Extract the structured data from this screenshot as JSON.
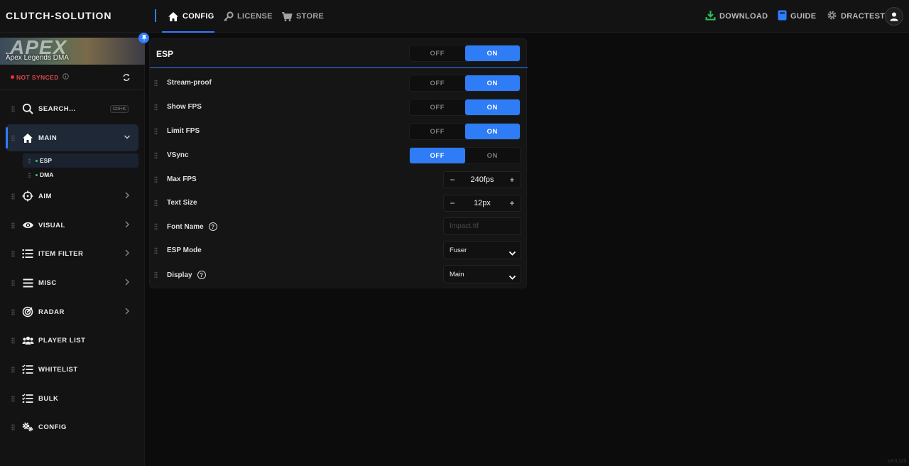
{
  "app": {
    "brand": "CLUTCH-SOLUTION",
    "version": "v3.0.113"
  },
  "topnav": [
    {
      "label": "CONFIG",
      "icon": "home-icon",
      "active": true
    },
    {
      "label": "LICENSE",
      "icon": "key-icon",
      "active": false
    },
    {
      "label": "STORE",
      "icon": "cart-icon",
      "active": false
    }
  ],
  "topright": {
    "download": "DOWNLOAD",
    "guide": "GUIDE",
    "user": "DRACTEST"
  },
  "sidebar": {
    "banner_logo": "APEX",
    "game": "Apex Legends DMA",
    "sync_status": "NOT SYNCED",
    "search": {
      "label": "SEARCH...",
      "shortcut": "Ctrl+K"
    },
    "items": [
      {
        "label": "MAIN",
        "icon": "home-icon"
      },
      {
        "label": "AIM",
        "icon": "crosshair-icon"
      },
      {
        "label": "VISUAL",
        "icon": "eye-icon"
      },
      {
        "label": "ITEM FILTER",
        "icon": "list-icon"
      },
      {
        "label": "MISC",
        "icon": "menu-icon"
      },
      {
        "label": "RADAR",
        "icon": "radar-icon"
      },
      {
        "label": "PLAYER LIST",
        "icon": "users-icon"
      },
      {
        "label": "WHITELIST",
        "icon": "checklist-icon"
      },
      {
        "label": "BULK",
        "icon": "checklist-icon"
      },
      {
        "label": "CONFIG",
        "icon": "gears-icon"
      }
    ],
    "subitems": [
      {
        "label": "ESP"
      },
      {
        "label": "DMA"
      }
    ]
  },
  "panel": {
    "title": "ESP",
    "off": "OFF",
    "on": "ON",
    "rows": [
      {
        "label": "Stream-proof"
      },
      {
        "label": "Show FPS"
      },
      {
        "label": "Limit FPS"
      },
      {
        "label": "VSync"
      },
      {
        "label": "Max FPS",
        "value": "240fps"
      },
      {
        "label": "Text Size",
        "value": "12px"
      },
      {
        "label": "Font Name",
        "placeholder": "Impact.ttf"
      },
      {
        "label": "ESP Mode",
        "value": "Fuser"
      },
      {
        "label": "Display",
        "value": "Main"
      }
    ]
  },
  "colors": {
    "accent": "#2e7cf6",
    "bg": "#0c0c0d",
    "panel": "#151516",
    "sync_red": "#ff2a2a",
    "sub_dot": "#3ec97a"
  }
}
